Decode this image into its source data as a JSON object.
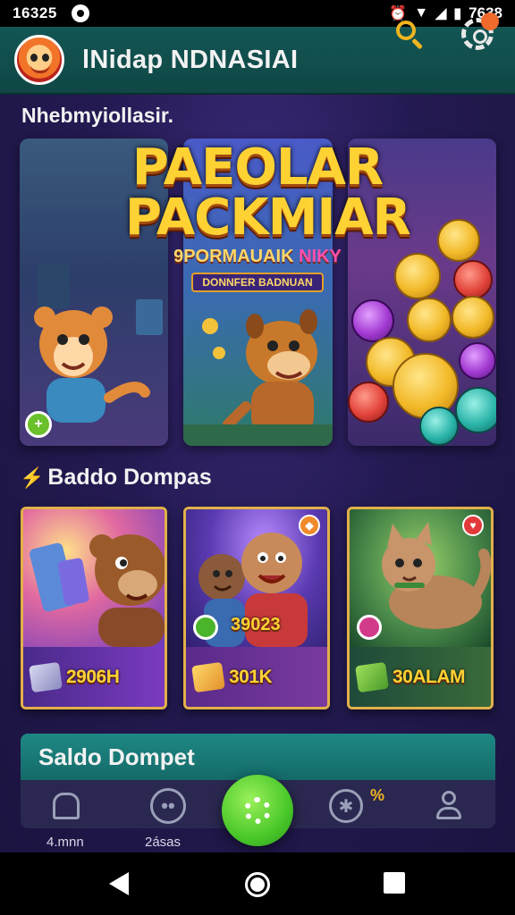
{
  "status_bar": {
    "time": "16325",
    "right_time": "7638"
  },
  "header": {
    "title": "lNidap NDNASIAI",
    "notification_count": ""
  },
  "sections": {
    "featured_title": "Nhebmyiollasir.",
    "games_title": "Baddo Dompas"
  },
  "banner": {
    "logo_line1": "PAEOLAR",
    "logo_line2": "PACKMIAR",
    "logo_sub": "9PORMAUAIK",
    "logo_sub_pink": "NIKY",
    "logo_strip": "DONNFER BADNUAN",
    "badge_icon": "plus-icon"
  },
  "game_cards": [
    {
      "name": "bear-card",
      "value": "2906H",
      "corner_icon": ""
    },
    {
      "name": "friends-card",
      "value": "301K",
      "mid_label": "39023",
      "corner_icon": "flag-icon"
    },
    {
      "name": "cat-card",
      "value": "30ALAM",
      "corner_icon": "heart-icon"
    }
  ],
  "wallet": {
    "title": "Saldo Dompet"
  },
  "bottom_nav": {
    "items": [
      {
        "icon": "home-icon",
        "label": "4.mnn"
      },
      {
        "icon": "gamepad-icon",
        "label": "2ásas"
      },
      {
        "icon": "settings-icon",
        "label": ""
      },
      {
        "icon": "spin-icon",
        "label": "",
        "extra": "%"
      },
      {
        "icon": "user-icon",
        "label": ""
      }
    ]
  },
  "colors": {
    "header_bg": "#135654",
    "accent_gold": "#f0b51f",
    "fab_green": "#4ac82a",
    "wallet_teal": "#1e8884"
  }
}
